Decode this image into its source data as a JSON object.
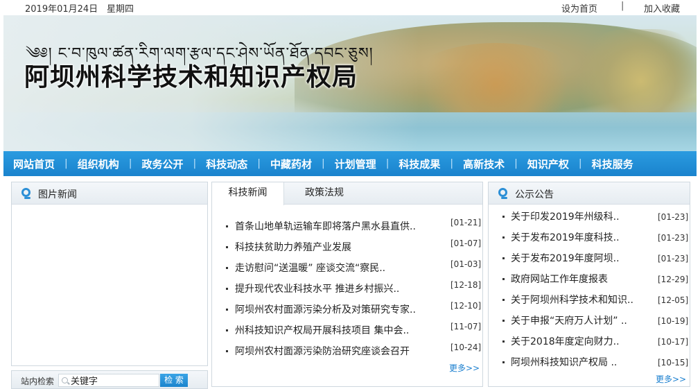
{
  "topbar": {
    "date": "2019年01月24日",
    "weekday": "星期四",
    "set_home": "设为首页",
    "separator": "|",
    "add_favorite": "加入收藏"
  },
  "banner": {
    "tibetan_title": "༄༅། ང་བ་ཁུལ་ཚན་རིག་ལག་རྩལ་དང་ཤེས་ཡོན་ཐོན་དབང་ཅུས།",
    "title": "阿坝州科学技术和知识产权局"
  },
  "nav": {
    "items": [
      {
        "label": "网站首页"
      },
      {
        "label": "组织机构"
      },
      {
        "label": "政务公开"
      },
      {
        "label": "科技动态"
      },
      {
        "label": "中藏药材"
      },
      {
        "label": "计划管理"
      },
      {
        "label": "科技成果"
      },
      {
        "label": "高新技术"
      },
      {
        "label": "知识产权"
      },
      {
        "label": "科技服务"
      }
    ],
    "divider": "|"
  },
  "picture_news": {
    "title": "图片新闻"
  },
  "news_tabs": {
    "tabs": [
      {
        "label": "科技新闻"
      },
      {
        "label": "政策法规"
      }
    ],
    "items": [
      {
        "title": "首条山地单轨运输车即将落户黑水县直供..",
        "date": "[01-21]"
      },
      {
        "title": "科技扶贫助力养殖产业发展",
        "date": "[01-07]"
      },
      {
        "title": "走访慰问“送温暖” 座谈交流“察民..",
        "date": "[01-03]"
      },
      {
        "title": "提升现代农业科技水平 推进乡村振兴..",
        "date": "[12-18]"
      },
      {
        "title": "阿坝州农村面源污染分析及对策研究专家..",
        "date": "[12-10]"
      },
      {
        "title": "州科技知识产权局开展科技项目 集中会..",
        "date": "[11-07]"
      },
      {
        "title": "阿坝州农村面源污染防治研究座谈会召开",
        "date": "[10-24]"
      }
    ],
    "more": "更多>>"
  },
  "notices": {
    "title": "公示公告",
    "items": [
      {
        "title": "关于印发2019年州级科..",
        "date": "[01-23]"
      },
      {
        "title": "关于发布2019年度科技..",
        "date": "[01-23]"
      },
      {
        "title": "关于发布2019年度阿坝..",
        "date": "[01-23]"
      },
      {
        "title": "政府网站工作年度报表",
        "date": "[12-29]"
      },
      {
        "title": "关于阿坝州科学技术和知识..",
        "date": "[12-05]"
      },
      {
        "title": "关于申报“天府万人计划” ..",
        "date": "[10-19]"
      },
      {
        "title": "关于2018年度定向财力..",
        "date": "[10-17]"
      },
      {
        "title": "阿坝州科技知识产权局 ..",
        "date": "[10-15]"
      }
    ],
    "more": "更多>>"
  },
  "search": {
    "label": "站内检索",
    "value": "关键字",
    "button": "检 索"
  }
}
